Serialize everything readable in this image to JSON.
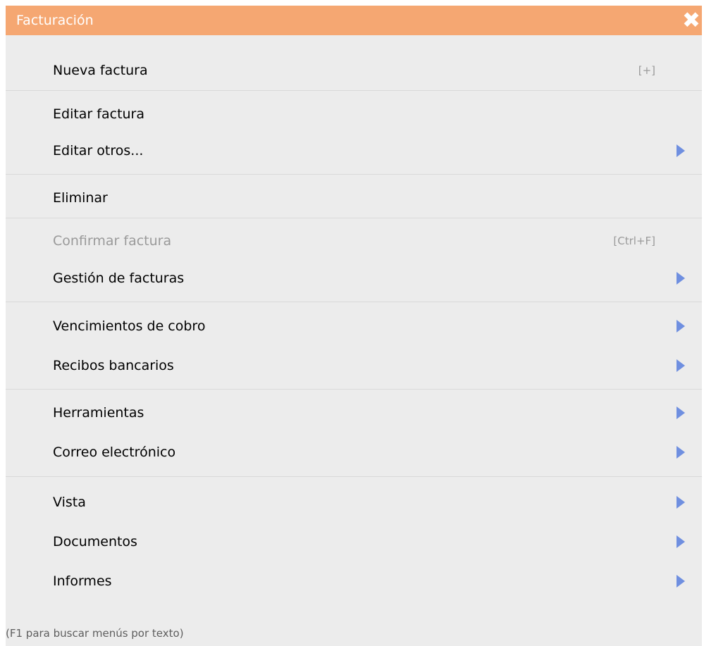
{
  "window": {
    "title": "Facturación",
    "close_label": "✖"
  },
  "menu": {
    "items": [
      {
        "label": "Nueva factura",
        "shortcut": "[+]",
        "submenu": false,
        "disabled": false
      },
      {
        "label": "Editar factura",
        "submenu": false,
        "disabled": false
      },
      {
        "label": "Editar otros...",
        "submenu": true,
        "disabled": false
      },
      {
        "label": "Eliminar",
        "submenu": false,
        "disabled": false
      },
      {
        "label": "Confirmar factura",
        "shortcut": "[Ctrl+F]",
        "submenu": false,
        "disabled": true
      },
      {
        "label": "Gestión de facturas",
        "submenu": true,
        "disabled": false
      },
      {
        "label": "Vencimientos de cobro",
        "submenu": true,
        "disabled": false
      },
      {
        "label": "Recibos bancarios",
        "submenu": true,
        "disabled": false
      },
      {
        "label": "Herramientas",
        "submenu": true,
        "disabled": false
      },
      {
        "label": "Correo electrónico",
        "submenu": true,
        "disabled": false
      },
      {
        "label": "Vista",
        "submenu": true,
        "disabled": false
      },
      {
        "label": "Documentos",
        "submenu": true,
        "disabled": false
      },
      {
        "label": "Informes",
        "submenu": true,
        "disabled": false
      }
    ]
  },
  "footer": {
    "hint": "(F1 para buscar menús por texto)"
  },
  "colors": {
    "titlebar": "#f5a772",
    "submenu_arrow": "#6f8fe0",
    "disabled_text": "#9a9a9a"
  }
}
